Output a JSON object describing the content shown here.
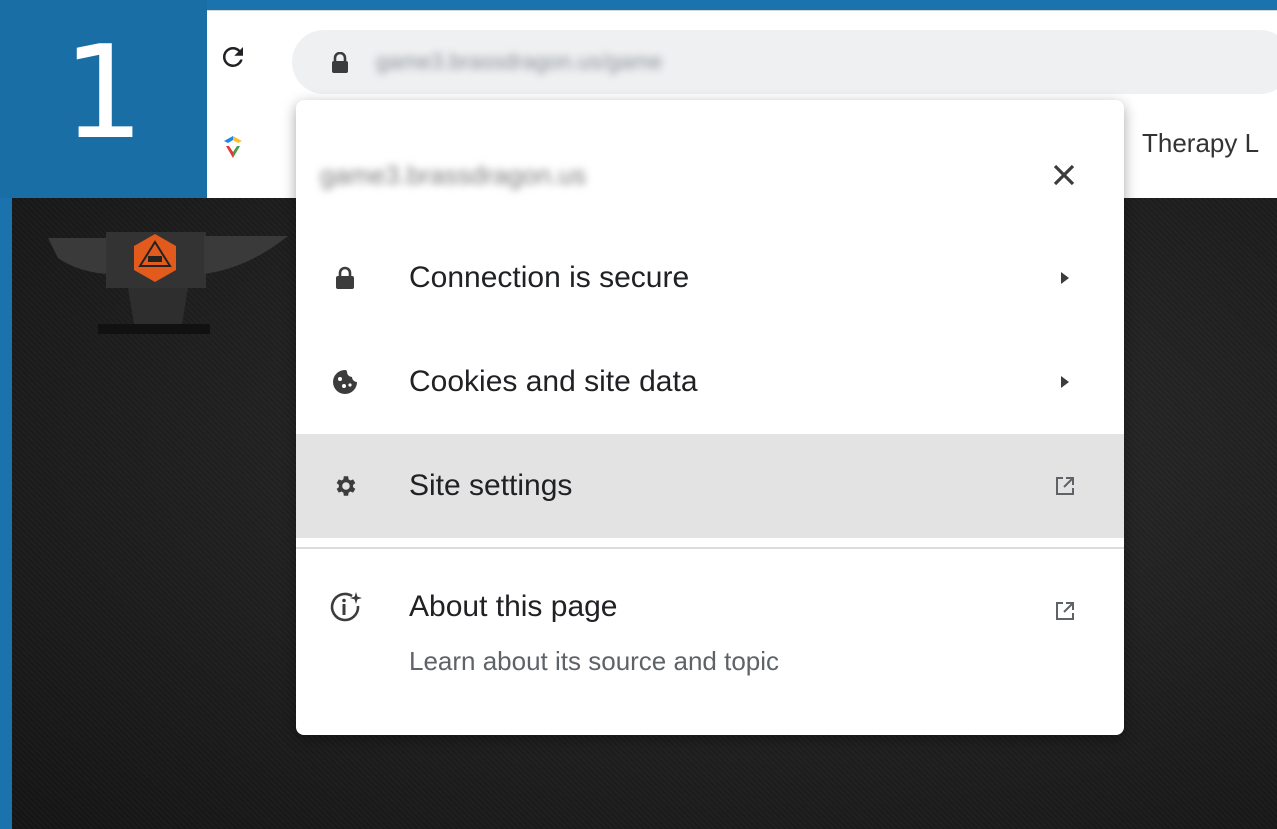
{
  "step": {
    "number": "1"
  },
  "toolbar": {
    "reload_icon": "reload-icon",
    "lock_icon": "lock-icon",
    "url": "game3.brassdragon.us/game"
  },
  "bookmarks": {
    "items": [
      {
        "icon": "bookmark-favicon"
      },
      {
        "label": "Therapy L"
      }
    ]
  },
  "popup": {
    "origin": "game3.brassdragon.us",
    "close_icon": "close-icon",
    "items": [
      {
        "label": "Connection is secure",
        "icon": "lock-icon",
        "trail": "chevron-right-icon"
      },
      {
        "label": "Cookies and site data",
        "icon": "cookie-icon",
        "trail": "chevron-right-icon"
      },
      {
        "label": "Site settings",
        "icon": "gear-icon",
        "trail": "external-link-icon"
      }
    ],
    "about": {
      "label": "About this page",
      "sublabel": "Learn about its source and topic",
      "icon": "info-spark-icon",
      "trail": "external-link-icon"
    }
  },
  "colors": {
    "badge": "#1a6ea6",
    "highlight_row": "#e3e3e3",
    "page_bg": "#1d1d1d"
  }
}
